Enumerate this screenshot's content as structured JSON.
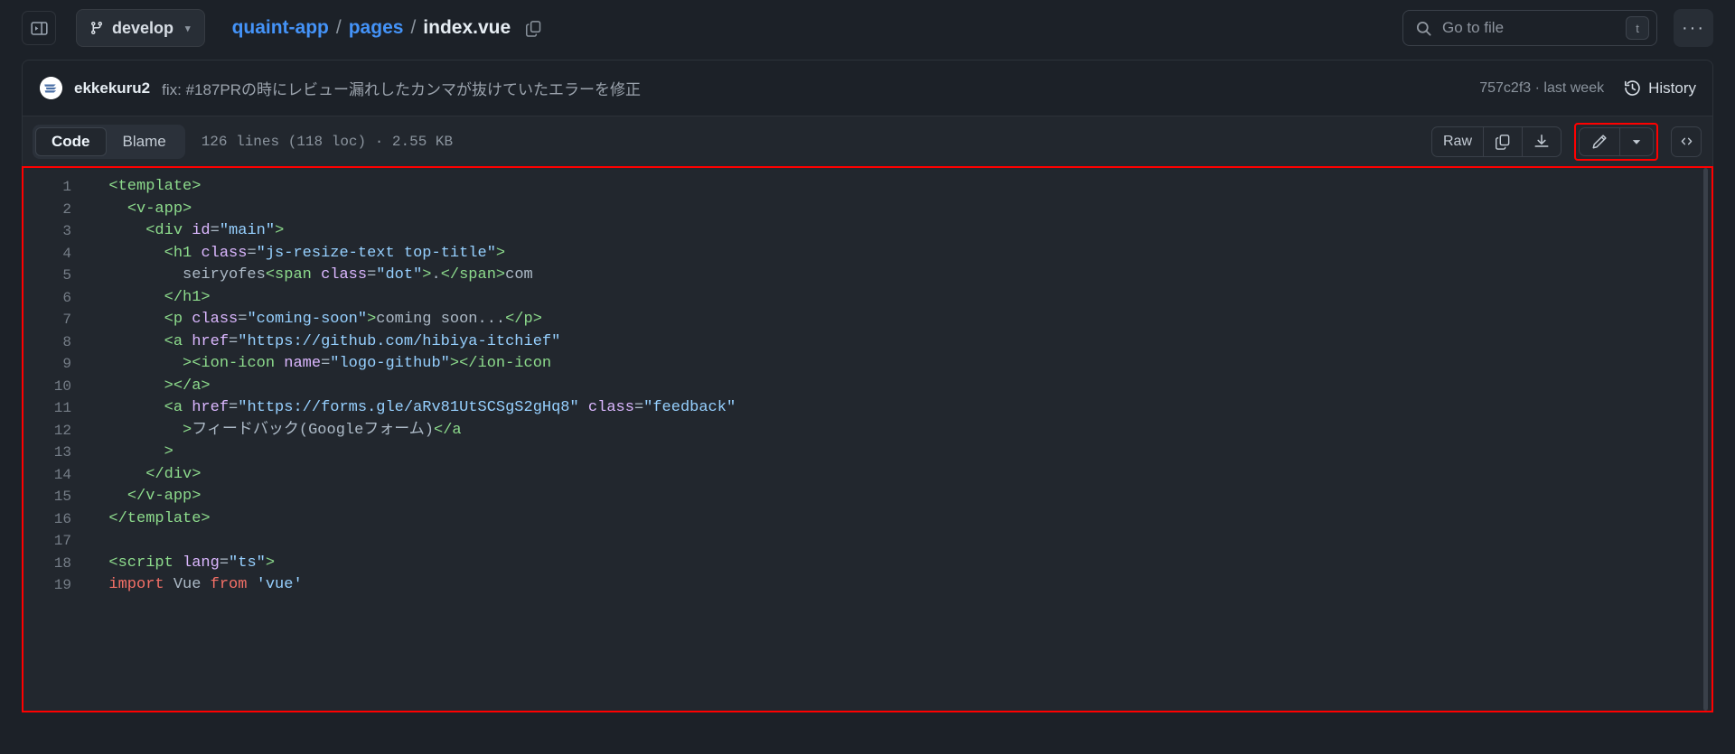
{
  "header": {
    "sidebar_toggle_icon": "sidebar-expand-icon",
    "branch": {
      "icon": "git-branch-icon",
      "label": "develop",
      "caret": "▾"
    },
    "breadcrumb": {
      "repo": "quaint-app",
      "sep": "/",
      "folder": "pages",
      "file": "index.vue",
      "copy_icon": "copy-path-icon"
    },
    "search": {
      "icon": "search-icon",
      "placeholder": "Go to file",
      "shortcut_key": "t"
    },
    "more_label": "···"
  },
  "commit": {
    "avatar_alt": "ekkekuru2 avatar",
    "author": "ekkekuru2",
    "message": "fix: #187PRの時にレビュー漏れしたカンマが抜けていたエラーを修正",
    "sha": "757c2f3",
    "separator": "·",
    "relative_time": "last week",
    "history_icon": "history-clock-icon",
    "history_label": "History"
  },
  "file_toolbar": {
    "tabs": [
      {
        "label": "Code",
        "active": true
      },
      {
        "label": "Blame",
        "active": false
      }
    ],
    "stats": "126 lines (118 loc) · 2.55 KB",
    "raw_label": "Raw",
    "copy_icon": "copy-raw-icon",
    "download_icon": "download-icon",
    "edit_icon": "pencil-edit-icon",
    "edit_caret_icon": "chevron-down-icon",
    "symbols_icon": "code-symbols-icon",
    "highlight_color": "#ff0000"
  },
  "code": {
    "language": "vue",
    "lines": [
      {
        "n": "1",
        "tokens": [
          {
            "t": "plain",
            "v": "  "
          },
          {
            "t": "tag",
            "v": "<template>"
          }
        ]
      },
      {
        "n": "2",
        "tokens": [
          {
            "t": "plain",
            "v": "    "
          },
          {
            "t": "tag",
            "v": "<v-app>"
          }
        ]
      },
      {
        "n": "3",
        "tokens": [
          {
            "t": "plain",
            "v": "      "
          },
          {
            "t": "tag",
            "v": "<div "
          },
          {
            "t": "attr",
            "v": "id"
          },
          {
            "t": "punct",
            "v": "="
          },
          {
            "t": "str",
            "v": "\"main\""
          },
          {
            "t": "tag",
            "v": ">"
          }
        ]
      },
      {
        "n": "4",
        "tokens": [
          {
            "t": "plain",
            "v": "        "
          },
          {
            "t": "tag",
            "v": "<h1 "
          },
          {
            "t": "attr",
            "v": "class"
          },
          {
            "t": "punct",
            "v": "="
          },
          {
            "t": "str",
            "v": "\"js-resize-text top-title\""
          },
          {
            "t": "tag",
            "v": ">"
          }
        ]
      },
      {
        "n": "5",
        "tokens": [
          {
            "t": "plain",
            "v": "          seiryofes"
          },
          {
            "t": "tag",
            "v": "<span "
          },
          {
            "t": "attr",
            "v": "class"
          },
          {
            "t": "punct",
            "v": "="
          },
          {
            "t": "str",
            "v": "\"dot\""
          },
          {
            "t": "tag",
            "v": ">"
          },
          {
            "t": "plain",
            "v": "."
          },
          {
            "t": "tag",
            "v": "</span>"
          },
          {
            "t": "plain",
            "v": "com"
          }
        ]
      },
      {
        "n": "6",
        "tokens": [
          {
            "t": "plain",
            "v": "        "
          },
          {
            "t": "tag",
            "v": "</h1>"
          }
        ]
      },
      {
        "n": "7",
        "tokens": [
          {
            "t": "plain",
            "v": "        "
          },
          {
            "t": "tag",
            "v": "<p "
          },
          {
            "t": "attr",
            "v": "class"
          },
          {
            "t": "punct",
            "v": "="
          },
          {
            "t": "str",
            "v": "\"coming-soon\""
          },
          {
            "t": "tag",
            "v": ">"
          },
          {
            "t": "plain",
            "v": "coming soon..."
          },
          {
            "t": "tag",
            "v": "</p>"
          }
        ]
      },
      {
        "n": "8",
        "tokens": [
          {
            "t": "plain",
            "v": "        "
          },
          {
            "t": "tag",
            "v": "<a "
          },
          {
            "t": "attr",
            "v": "href"
          },
          {
            "t": "punct",
            "v": "="
          },
          {
            "t": "str",
            "v": "\"https://github.com/hibiya-itchief\""
          }
        ]
      },
      {
        "n": "9",
        "tokens": [
          {
            "t": "plain",
            "v": "          "
          },
          {
            "t": "tag",
            "v": "><ion-icon "
          },
          {
            "t": "attr",
            "v": "name"
          },
          {
            "t": "punct",
            "v": "="
          },
          {
            "t": "str",
            "v": "\"logo-github\""
          },
          {
            "t": "tag",
            "v": "></ion-icon"
          }
        ]
      },
      {
        "n": "10",
        "tokens": [
          {
            "t": "plain",
            "v": "        "
          },
          {
            "t": "tag",
            "v": "></a>"
          }
        ]
      },
      {
        "n": "11",
        "tokens": [
          {
            "t": "plain",
            "v": "        "
          },
          {
            "t": "tag",
            "v": "<a "
          },
          {
            "t": "attr",
            "v": "href"
          },
          {
            "t": "punct",
            "v": "="
          },
          {
            "t": "str",
            "v": "\"https://forms.gle/aRv81UtSCSgS2gHq8\""
          },
          {
            "t": "plain",
            "v": " "
          },
          {
            "t": "attr",
            "v": "class"
          },
          {
            "t": "punct",
            "v": "="
          },
          {
            "t": "str",
            "v": "\"feedback\""
          }
        ]
      },
      {
        "n": "12",
        "tokens": [
          {
            "t": "plain",
            "v": "          "
          },
          {
            "t": "tag",
            "v": ">"
          },
          {
            "t": "plain",
            "v": "フィードバック(Googleフォーム)"
          },
          {
            "t": "tag",
            "v": "</a"
          }
        ]
      },
      {
        "n": "13",
        "tokens": [
          {
            "t": "plain",
            "v": "        "
          },
          {
            "t": "tag",
            "v": ">"
          }
        ]
      },
      {
        "n": "14",
        "tokens": [
          {
            "t": "plain",
            "v": "      "
          },
          {
            "t": "tag",
            "v": "</div>"
          }
        ]
      },
      {
        "n": "15",
        "tokens": [
          {
            "t": "plain",
            "v": "    "
          },
          {
            "t": "tag",
            "v": "</v-app>"
          }
        ]
      },
      {
        "n": "16",
        "tokens": [
          {
            "t": "plain",
            "v": "  "
          },
          {
            "t": "tag",
            "v": "</template>"
          }
        ]
      },
      {
        "n": "17",
        "tokens": [
          {
            "t": "plain",
            "v": ""
          }
        ]
      },
      {
        "n": "18",
        "tokens": [
          {
            "t": "plain",
            "v": "  "
          },
          {
            "t": "tag",
            "v": "<script "
          },
          {
            "t": "attr",
            "v": "lang"
          },
          {
            "t": "punct",
            "v": "="
          },
          {
            "t": "str",
            "v": "\"ts\""
          },
          {
            "t": "tag",
            "v": ">"
          }
        ]
      },
      {
        "n": "19",
        "tokens": [
          {
            "t": "plain",
            "v": "  "
          },
          {
            "t": "kw",
            "v": "import"
          },
          {
            "t": "plain",
            "v": " Vue "
          },
          {
            "t": "kw",
            "v": "from"
          },
          {
            "t": "plain",
            "v": " "
          },
          {
            "t": "str",
            "v": "'vue'"
          }
        ]
      }
    ]
  }
}
